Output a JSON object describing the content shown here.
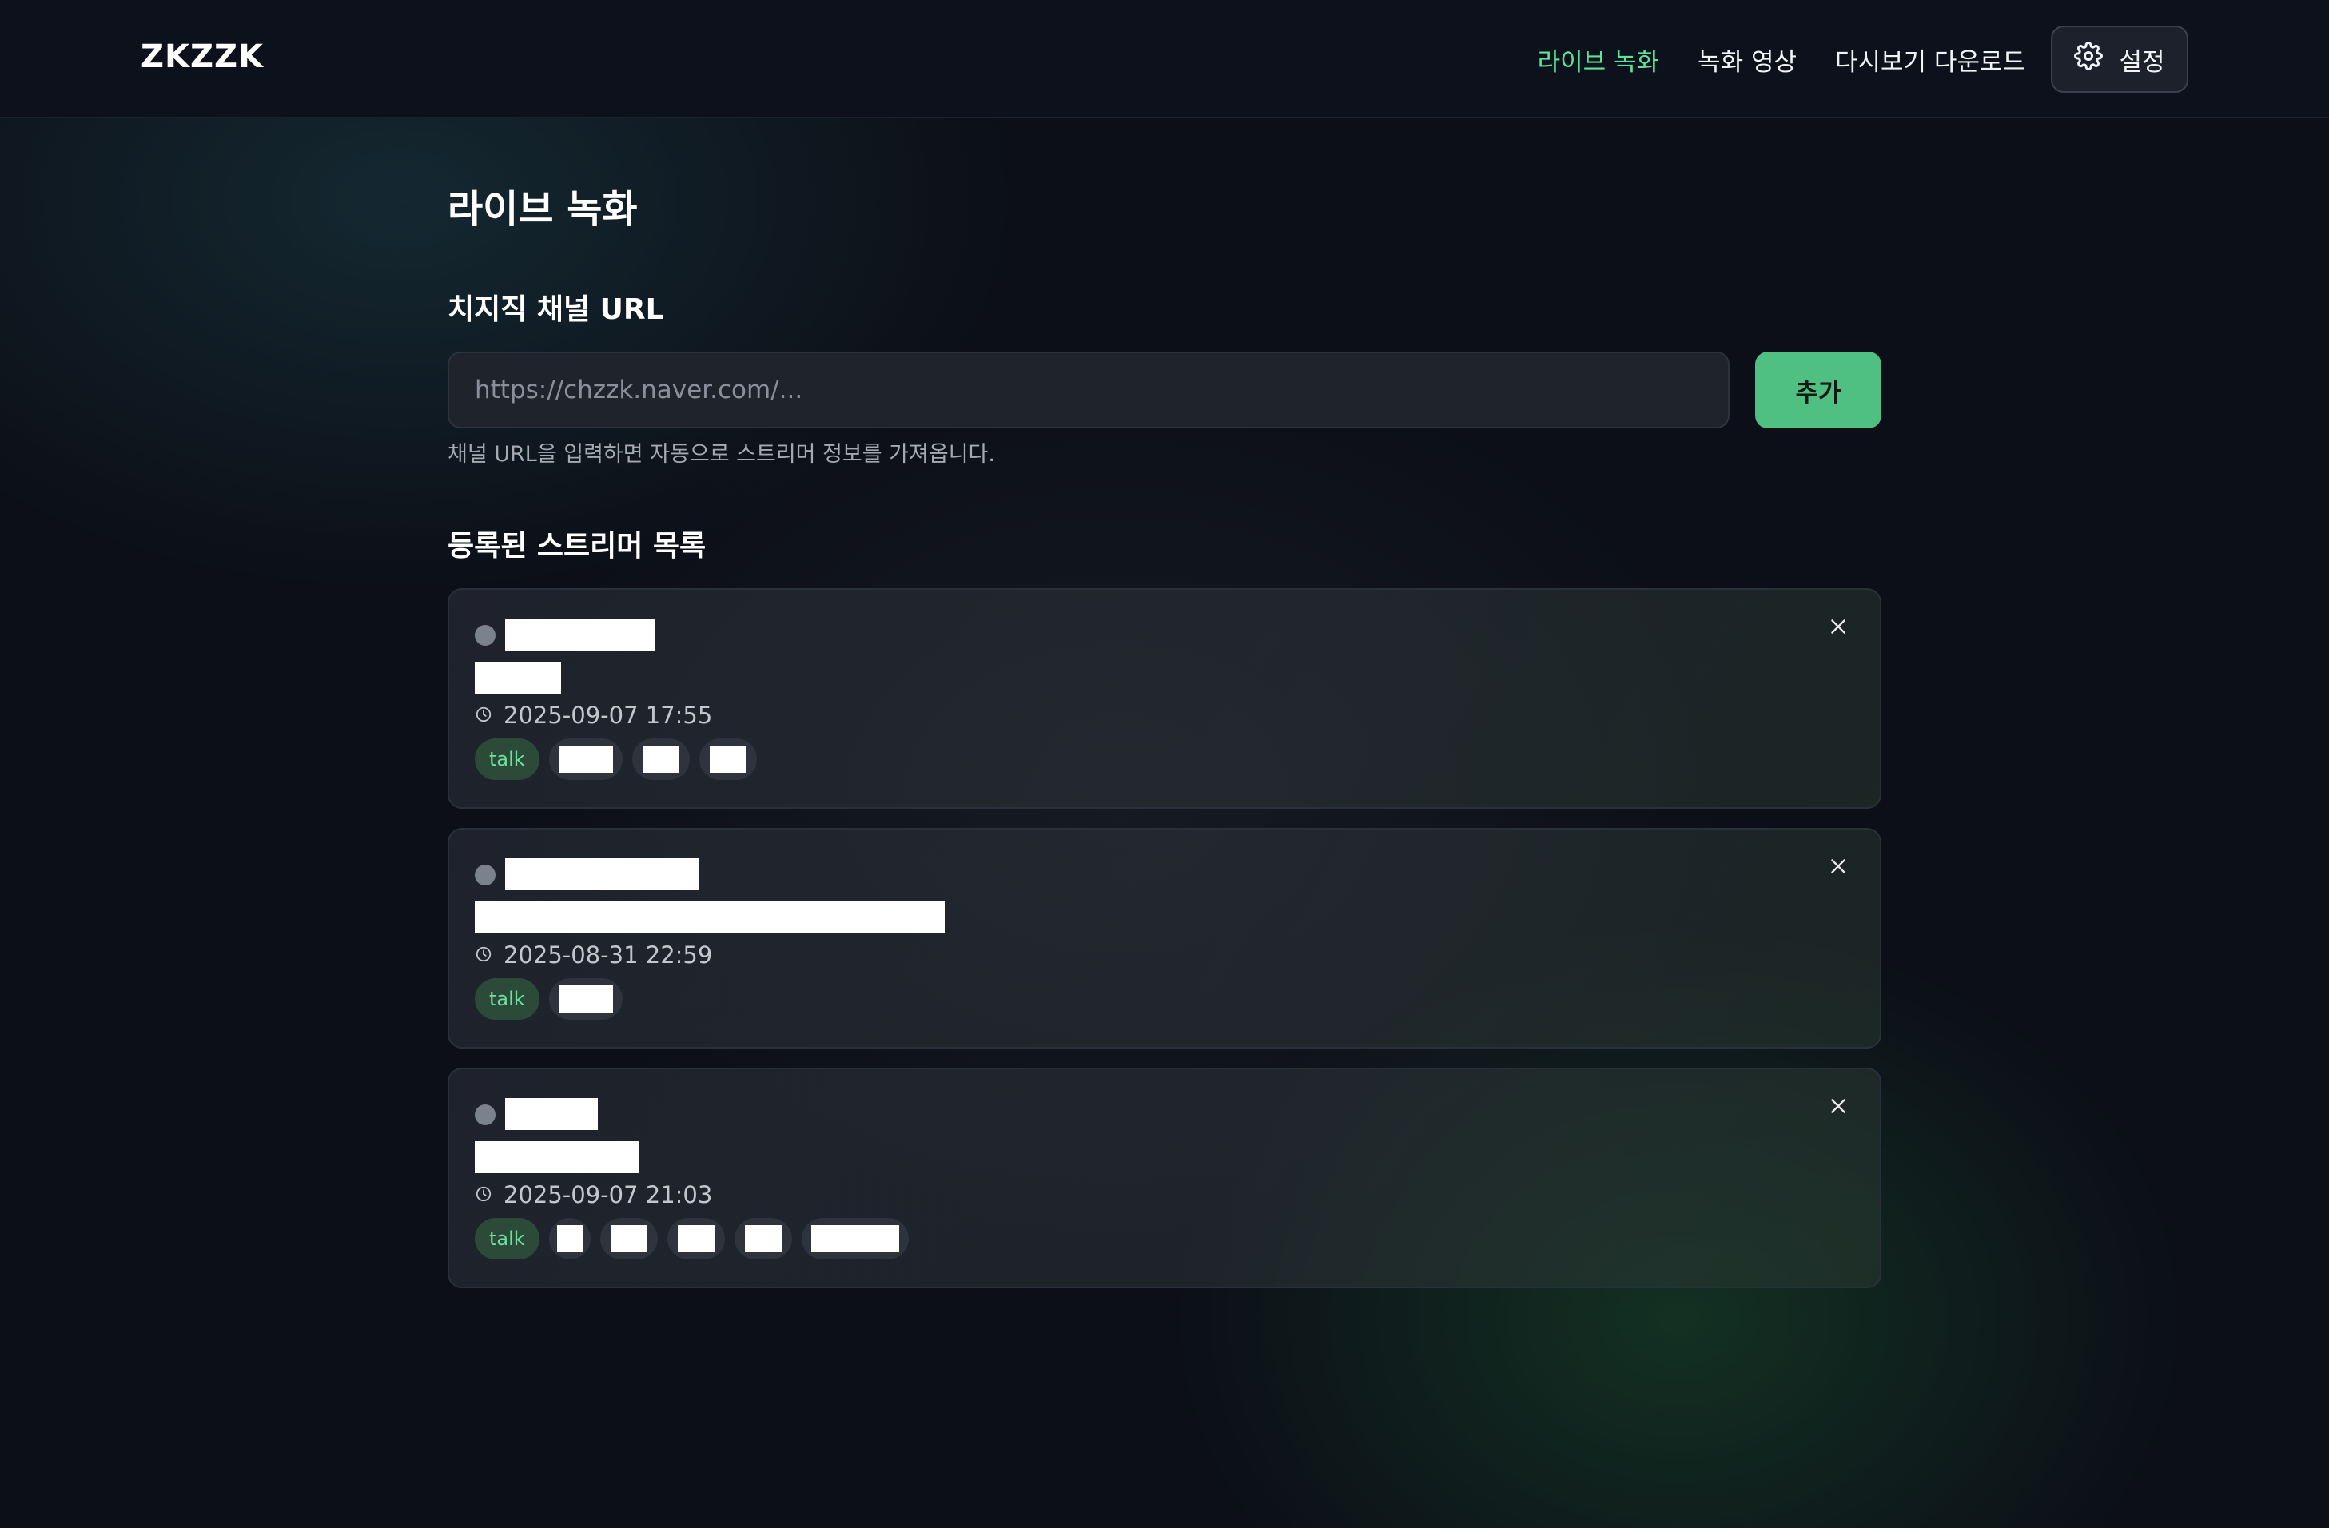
{
  "app": {
    "logo": "ZKZZK"
  },
  "nav": {
    "items": [
      {
        "label": "라이브 녹화",
        "active": true
      },
      {
        "label": "녹화 영상",
        "active": false
      },
      {
        "label": "다시보기 다운로드",
        "active": false
      }
    ],
    "settings_label": "설정",
    "settings_icon": "gear-icon"
  },
  "page": {
    "title": "라이브 녹화",
    "url_section_title": "치지직 채널 URL",
    "url_input": {
      "value": "",
      "placeholder": "https://chzzk.naver.com/..."
    },
    "add_button_label": "추가",
    "hint": "채널 URL을 입력하면 자동으로 스트리머 정보를 가져옵니다.",
    "list_title": "등록된 스트리머 목록"
  },
  "streamers": [
    {
      "status": "offline",
      "last_live": "2025-09-07 17:55",
      "tags": [
        "talk"
      ],
      "redacted_tag_count": 3
    },
    {
      "status": "offline",
      "last_live": "2025-08-31 22:59",
      "tags": [
        "talk"
      ],
      "redacted_tag_count": 1
    },
    {
      "status": "offline",
      "last_live": "2025-09-07 21:03",
      "tags": [
        "talk"
      ],
      "redacted_tag_count": 5
    }
  ],
  "colors": {
    "accent": "#5ee29a",
    "button": "#4fbf82",
    "offline_dot": "#7c828d",
    "background": "#0c0f17"
  }
}
